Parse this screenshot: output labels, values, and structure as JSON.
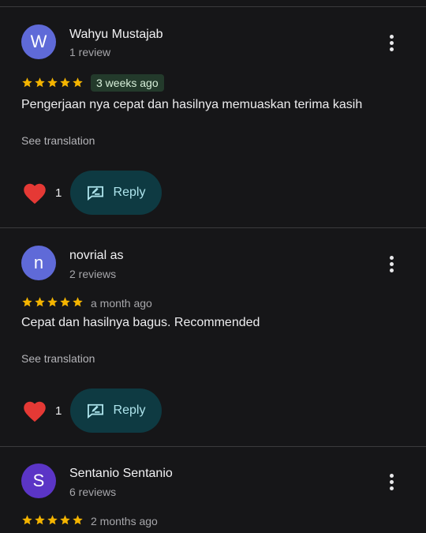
{
  "colors": {
    "background": "#161618",
    "star": "#f4b400",
    "reply_bg": "#0e3a42",
    "reply_text": "#aee4ec",
    "heart": "#e53935",
    "avatar_1": "#5f6ad8",
    "avatar_2": "#5f6ad8",
    "avatar_3": "#5b35c6"
  },
  "reviews": [
    {
      "avatar_letter": "W",
      "name": "Wahyu Mustajab",
      "review_count": "1 review",
      "rating": 5,
      "date": "3 weeks ago",
      "text": "Pengerjaan nya cepat dan hasilnya memuaskan terima kasih",
      "translate_label": "See translation",
      "likes": "1",
      "reply_label": "Reply",
      "icons": {
        "like": "heart-icon",
        "reply": "reply-edit-icon",
        "menu": "more-vert-icon"
      }
    },
    {
      "avatar_letter": "n",
      "name": "novrial as",
      "review_count": "2 reviews",
      "rating": 5,
      "date": "a month ago",
      "text": "Cepat dan hasilnya bagus. Recommended",
      "translate_label": "See translation",
      "likes": "1",
      "reply_label": "Reply",
      "icons": {
        "like": "heart-icon",
        "reply": "reply-edit-icon",
        "menu": "more-vert-icon"
      }
    },
    {
      "avatar_letter": "S",
      "name": "Sentanio Sentanio",
      "review_count": "6 reviews",
      "rating": 5,
      "date": "2 months ago",
      "icons": {
        "menu": "more-vert-icon"
      }
    }
  ]
}
